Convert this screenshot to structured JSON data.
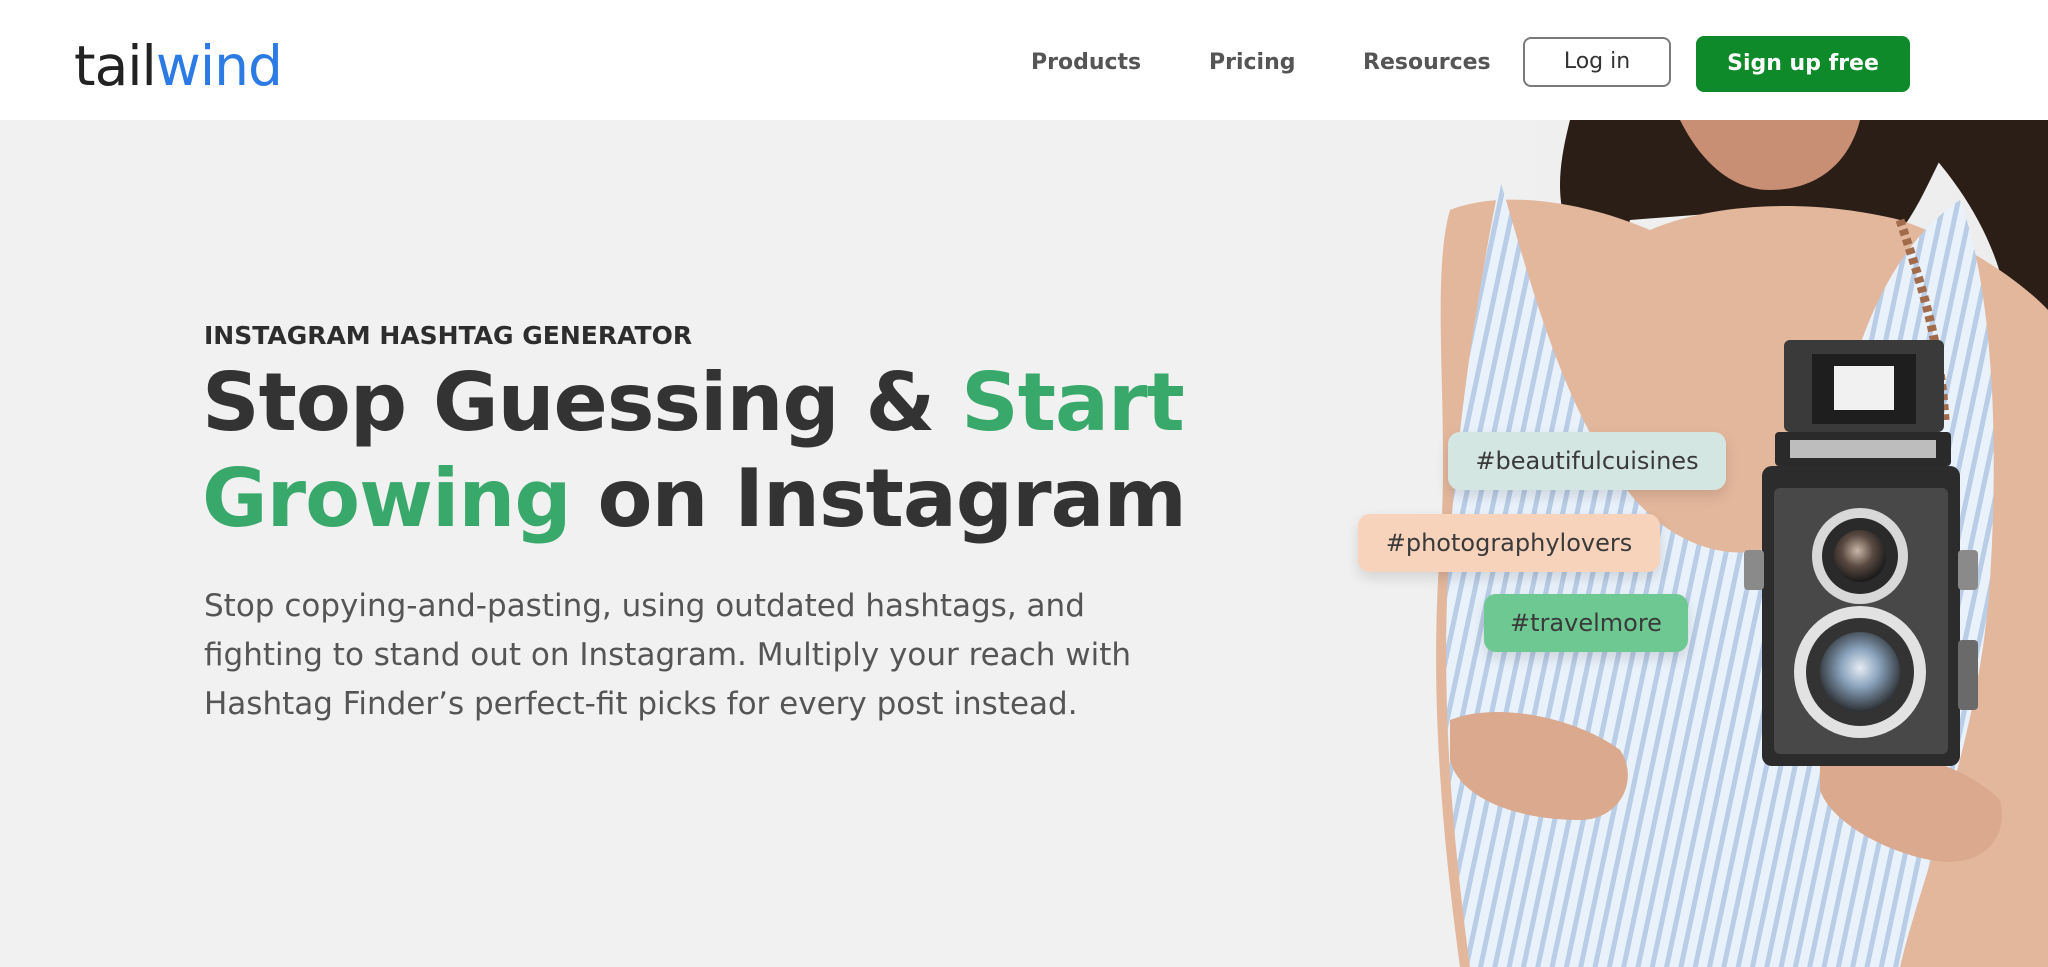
{
  "header": {
    "logo": {
      "part1": "tail",
      "part2": "wind"
    },
    "nav": [
      {
        "label": "Products"
      },
      {
        "label": "Pricing"
      },
      {
        "label": "Resources"
      }
    ],
    "login_label": "Log in",
    "signup_label": "Sign up free"
  },
  "hero": {
    "eyebrow": "INSTAGRAM HASHTAG GENERATOR",
    "headline": {
      "part1": "Stop Guessing & ",
      "part2": "Start",
      "part3": "Growing",
      "part4": " on Instagram"
    },
    "subtext": [
      "Stop copying-and-pasting, using outdated hashtags, and",
      "fighting to stand out on Instagram. Multiply your reach with",
      "Hashtag Finder’s perfect-fit picks for every post instead."
    ],
    "hashtags": [
      {
        "text": "#beautifulcuisines",
        "color": "#d4e6e2"
      },
      {
        "text": "#photographylovers",
        "color": "#f8d3bc"
      },
      {
        "text": "#travelmore",
        "color": "#6dc891"
      }
    ]
  },
  "colors": {
    "brand_blue": "#2c7be5",
    "accent_green": "#38a96a",
    "signup_green": "#0e8a2a",
    "hero_background": "#f1f1f1"
  }
}
